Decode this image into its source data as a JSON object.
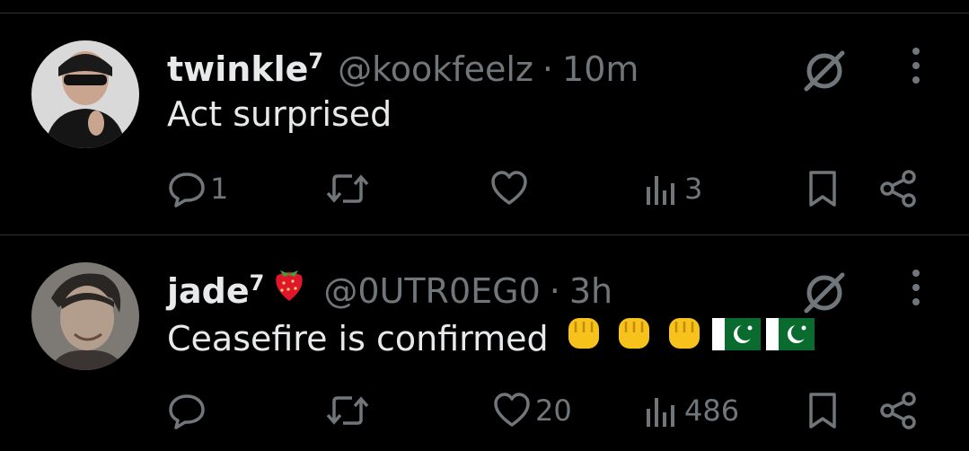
{
  "tweets": [
    {
      "display_name": "twinkle",
      "name_sup": "7",
      "name_emoji": "",
      "handle": "@kookfeelz",
      "separator": "·",
      "time": "10m",
      "text": "Act surprised",
      "text_emojis": [],
      "replies": "1",
      "retweets": "",
      "likes": "",
      "views": "3",
      "avatar_icon": "avatar-sunglasses-person"
    },
    {
      "display_name": "jade",
      "name_sup": "7",
      "name_emoji": "strawberry",
      "handle": "@0UTR0EG0",
      "separator": "·",
      "time": "3h",
      "text": "Ceasefire is confirmed",
      "text_emojis": [
        "raised-fist",
        "raised-fist",
        "raised-fist",
        "pakistan-flag",
        "pakistan-flag"
      ],
      "replies": "",
      "retweets": "",
      "likes": "20",
      "views": "486",
      "avatar_icon": "avatar-person-face-paint"
    }
  ],
  "colors": {
    "background": "#000000",
    "text": "#e7e9ea",
    "muted": "#71767b",
    "divider": "#2f3336"
  },
  "icons": [
    "reply-icon",
    "retweet-icon",
    "like-icon",
    "views-icon",
    "bookmark-icon",
    "share-icon",
    "grok-icon",
    "more-icon"
  ]
}
